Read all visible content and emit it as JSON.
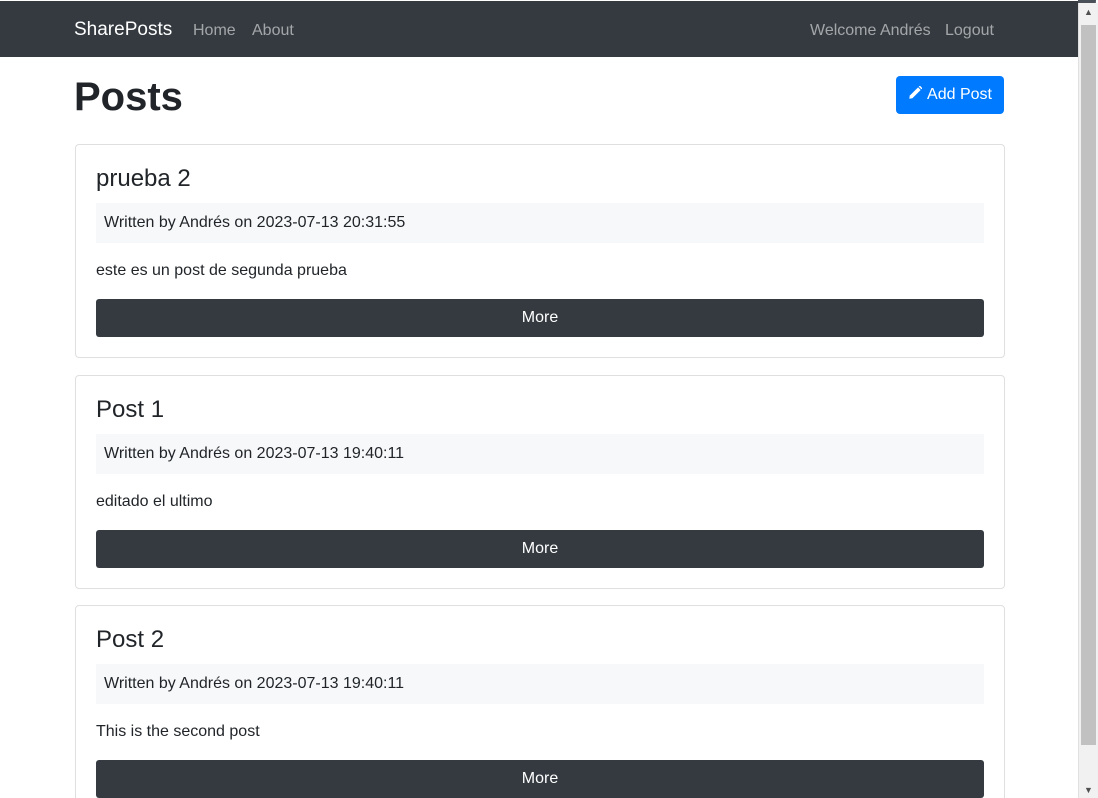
{
  "navbar": {
    "brand": "SharePosts",
    "links": [
      "Home",
      "About"
    ],
    "welcome": "Welcome Andrés",
    "logout": "Logout"
  },
  "page": {
    "title": "Posts",
    "add_button": "Add Post",
    "add_icon": "pencil-icon"
  },
  "posts": [
    {
      "title": "prueba 2",
      "meta": "Written by Andrés on 2023-07-13 20:31:55",
      "body": "este es un post de segunda prueba",
      "button": "More"
    },
    {
      "title": "Post 1",
      "meta": "Written by Andrés on 2023-07-13 19:40:11",
      "body": "editado el ultimo",
      "button": "More"
    },
    {
      "title": "Post 2",
      "meta": "Written by Andrés on 2023-07-13 19:40:11",
      "body": "This is the second post",
      "button": "More"
    }
  ],
  "colors": {
    "navbar": "#343a40",
    "primary": "#007bff",
    "dark_button": "#343a40"
  }
}
